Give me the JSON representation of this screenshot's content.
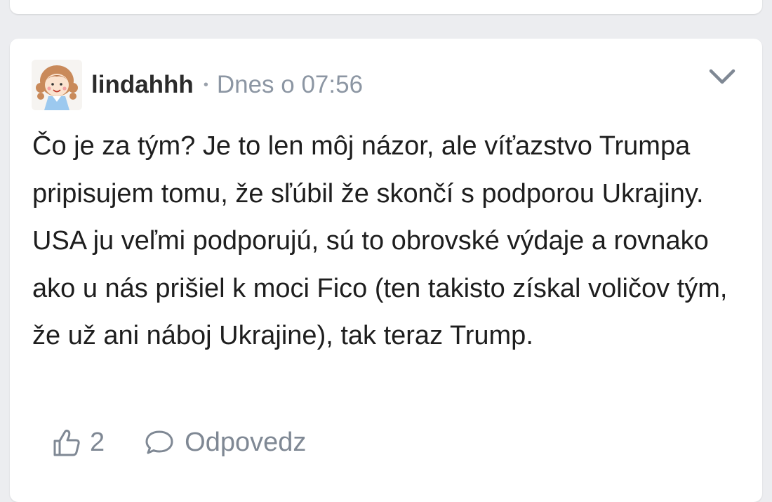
{
  "comment": {
    "username": "lindahhh",
    "separator": "•",
    "timestamp": "Dnes o 07:56",
    "avatar_icon": "cartoon-girl-avatar",
    "menu_icon": "chevron-down-icon",
    "text": "Čo je za tým? Je to len môj názor, ale víťazstvo Trumpa pripisujem tomu, že sľúbil že skončí s podporou Ukrajiny. USA ju veľmi podporujú, sú to obrovské výdaje a rovnako ako u nás prišiel k moci Fico (ten takisto získal voličov tým, že už ani náboj Ukrajine), tak teraz Trump.",
    "likes": "2",
    "like_icon": "thumbs-up-icon",
    "reply_icon": "speech-bubble-icon",
    "reply_label": "Odpovedz"
  },
  "colors": {
    "background": "#ecedf0",
    "card": "#ffffff",
    "muted": "#8c96a3",
    "text": "#1e1e1e"
  }
}
